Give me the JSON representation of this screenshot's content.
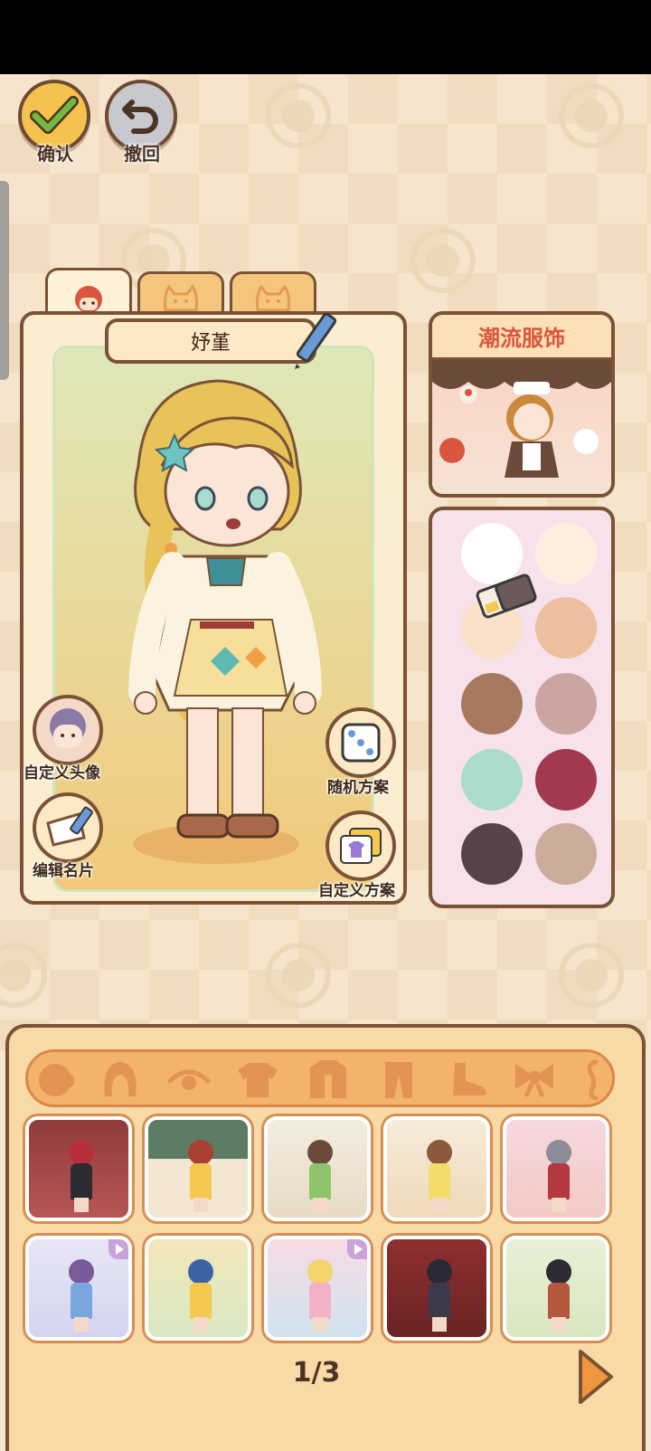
{
  "top_buttons": {
    "confirm_label": "确认",
    "undo_label": "撤回"
  },
  "name_field": {
    "value": "妤堇"
  },
  "side_actions": {
    "custom_avatar": "自定义头像",
    "edit_card": "编辑名片",
    "random_plan": "随机方案",
    "custom_plan": "自定义方案"
  },
  "theme_card": {
    "title": "潮流服饰"
  },
  "palette": {
    "colors": [
      "#ffffff",
      "#fdeee0",
      "#fbe1c9",
      "#edbf9e",
      "#a77a60",
      "#caa5a2",
      "#a9dccd",
      "#a13a4e",
      "#54434b",
      "#ccab9b"
    ]
  },
  "outfit_grid": {
    "page_indicator": "1/3"
  },
  "colors": {
    "accent": "#d9553d",
    "border": "#7b5236",
    "confirm": "#73b83f"
  }
}
